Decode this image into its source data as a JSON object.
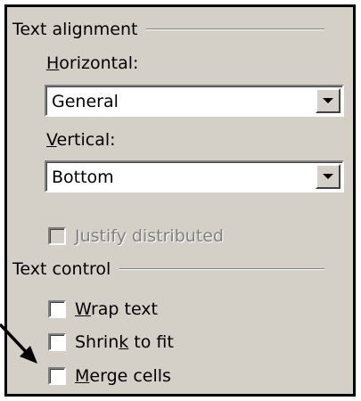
{
  "text_alignment": {
    "group_title": "Text alignment",
    "horizontal_label_mnemonic": "H",
    "horizontal_label_rest": "orizontal:",
    "horizontal_value": "General",
    "vertical_label_mnemonic": "V",
    "vertical_label_rest": "ertical:",
    "vertical_value": "Bottom",
    "justify_distributed_label": "Justify distributed"
  },
  "text_control": {
    "group_title": "Text control",
    "wrap_text_mnemonic": "W",
    "wrap_text_rest": "rap text",
    "shrink_pre": "Shrin",
    "shrink_mnemonic": "k",
    "shrink_post": " to fit",
    "merge_mnemonic": "M",
    "merge_rest": "erge cells"
  },
  "colors": {
    "dialog_face": "#d4d0c8",
    "disabled_text": "#808080"
  }
}
